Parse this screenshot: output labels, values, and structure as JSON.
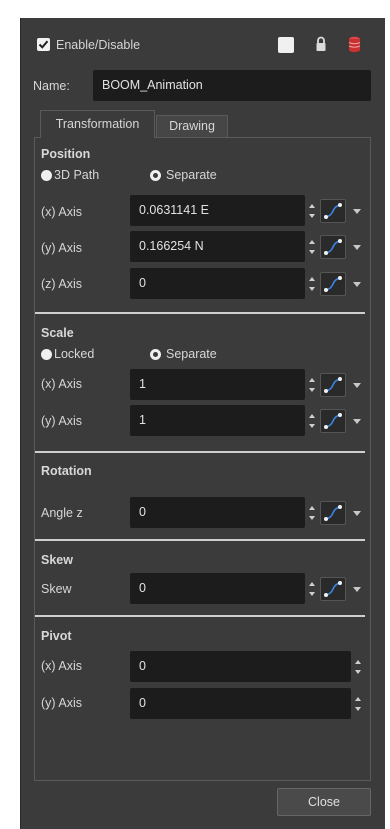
{
  "header": {
    "enable_label": "Enable/Disable",
    "enable_checked": true,
    "icons": [
      "color-swatch-icon",
      "lock-icon",
      "database-icon"
    ]
  },
  "name": {
    "label": "Name:",
    "value": "BOOM_Animation"
  },
  "tabs": [
    {
      "label": "Transformation",
      "active": true
    },
    {
      "label": "Drawing",
      "active": false
    }
  ],
  "position": {
    "title": "Position",
    "mode_3d_path": "3D Path",
    "mode_separate": "Separate",
    "x_label": "(x) Axis",
    "x_value": "0.0631141 E",
    "y_label": "(y) Axis",
    "y_value": "0.166254 N",
    "z_label": "(z) Axis",
    "z_value": "0"
  },
  "scale": {
    "title": "Scale",
    "mode_locked": "Locked",
    "mode_separate": "Separate",
    "x_label": "(x) Axis",
    "x_value": "1",
    "y_label": "(y) Axis",
    "y_value": "1"
  },
  "rotation": {
    "title": "Rotation",
    "angle_label": "Angle z",
    "angle_value": "0"
  },
  "skew": {
    "title": "Skew",
    "skew_label": "Skew",
    "skew_value": "0"
  },
  "pivot": {
    "title": "Pivot",
    "x_label": "(x) Axis",
    "x_value": "0",
    "y_label": "(y) Axis",
    "y_value": "0"
  },
  "footer": {
    "close_label": "Close"
  },
  "colors": {
    "panel": "#3b3b3b",
    "field": "#1c1c1c",
    "function_button": "#2a6fd1"
  }
}
